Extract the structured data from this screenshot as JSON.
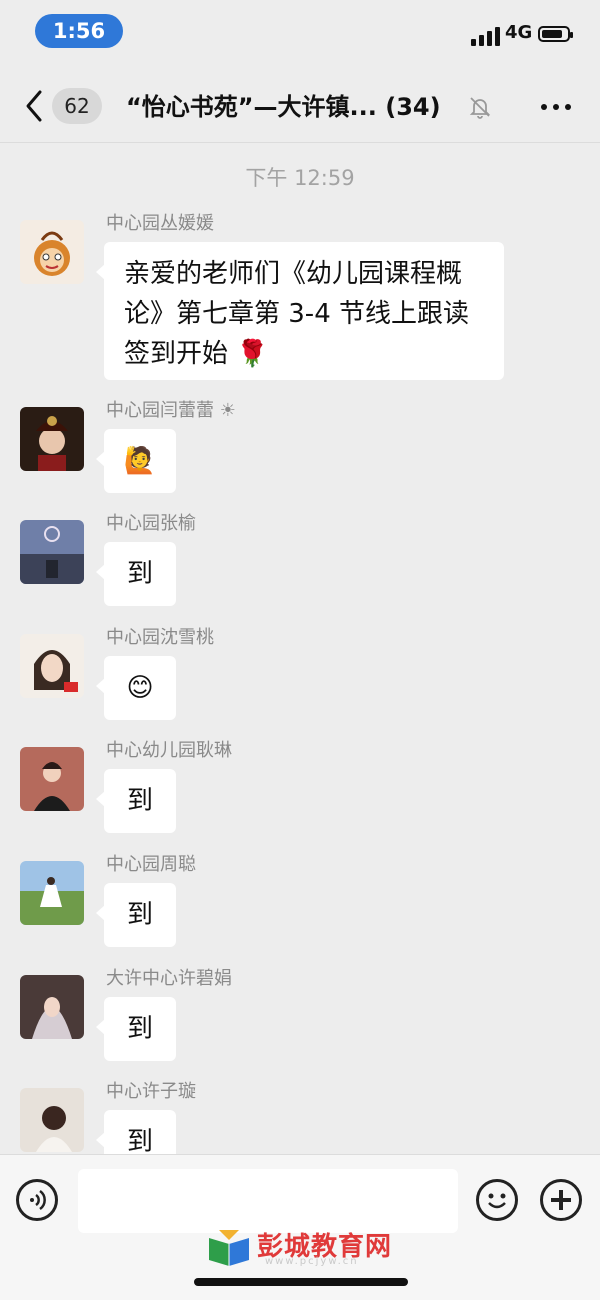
{
  "status_bar": {
    "time": "1:56",
    "network": "4G"
  },
  "nav": {
    "unread_count": "62",
    "title": "“怡心书苑”—大许镇... (34)"
  },
  "chat": {
    "timestamp": "下午 12:59",
    "messages": [
      {
        "sender": "中心园丛媛媛",
        "text": "亲爱的老师们《幼儿园课程概论》第七章第 3-4 节线上跟读签到开始 🌹"
      },
      {
        "sender": "中心园闫蕾蕾 ☀",
        "text": "🙋"
      },
      {
        "sender": "中心园张榆",
        "text": "到"
      },
      {
        "sender": "中心园沈雪桃",
        "text": "😊"
      },
      {
        "sender": "中心幼儿园耿琳",
        "text": "到"
      },
      {
        "sender": "中心园周聪",
        "text": "到"
      },
      {
        "sender": "大许中心许碧娟",
        "text": "到"
      },
      {
        "sender": "中心许子璇",
        "text": "到"
      }
    ]
  },
  "watermark": {
    "text": "彭城教育网",
    "url": "www.pcjyw.cn"
  }
}
